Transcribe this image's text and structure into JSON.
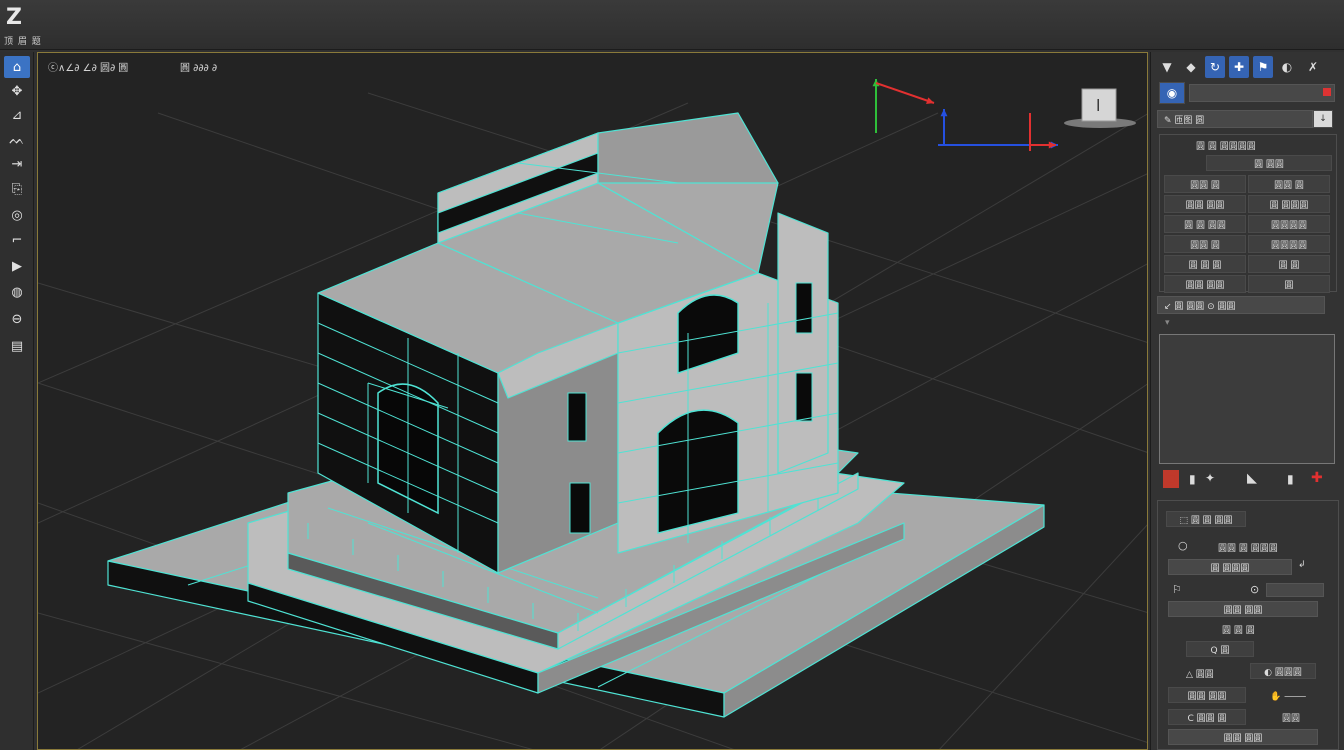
{
  "app": {
    "logo": "Z",
    "title": "顶 眉 题",
    "window_title": ""
  },
  "left_toolbar": {
    "items": [
      {
        "name": "home-tool",
        "glyph": "⌂",
        "active": true
      },
      {
        "name": "move-tool",
        "glyph": "✥"
      },
      {
        "name": "edge-tool",
        "glyph": "⊿"
      },
      {
        "name": "paint-tool",
        "glyph": "ᨓ"
      },
      {
        "name": "split-tool",
        "glyph": "⇥"
      },
      {
        "name": "render-tool",
        "glyph": "⎘"
      },
      {
        "name": "target-tool",
        "glyph": "◎"
      },
      {
        "name": "bevel-tool",
        "glyph": "⌐"
      },
      {
        "name": "camera-tool",
        "glyph": "▶"
      },
      {
        "name": "globe-tool",
        "glyph": "◍"
      },
      {
        "name": "layer-tool",
        "glyph": "⊖"
      },
      {
        "name": "stack-tool",
        "glyph": "▤"
      }
    ]
  },
  "viewport": {
    "label": "ⓒ∧∠∂ ∠∂ 圆∂ 圓",
    "label2": "圓 ∂∂∂ ∂",
    "view_cube_label": "l",
    "colors": {
      "wire": "#4fe3d4",
      "face_top": "#a9a9a9",
      "face_light": "#bdbdbd",
      "face_dark": "#101010",
      "face_mid": "#8c8c8c",
      "grid": "#3c3c3c",
      "axis_x": "#e23030",
      "axis_y": "#2fbf3a",
      "axis_z": "#2550e0"
    }
  },
  "right_panel": {
    "tabs": [
      "▼",
      "◆",
      "↻",
      "✚",
      "⚑",
      "◐",
      "✗"
    ],
    "search_value": "",
    "name_field": "✎ 匝图 圆",
    "name_field_right": "↓",
    "group1_title": "圓 圓 圓圓圓圓",
    "group1_subtitle": "圓 圓圓",
    "grid_buttons": [
      [
        "圓圓 圓",
        "圓圓 圓"
      ],
      [
        "圓圓 圓圓",
        "圓 圓圓圓"
      ],
      [
        "圓 圓 圓圓",
        "圓圓圓圓"
      ],
      [
        "圓圓 圓",
        "圓圓圓圓"
      ],
      [
        "圓 圓 圓",
        "圓 圓"
      ],
      [
        "圓圓 圓圓",
        "圓"
      ]
    ],
    "row_field": "↙ 圓 圓圓 ⊙ 圓圓",
    "swatch_tools": [
      "■",
      "▮",
      "✦",
      "◣",
      "▮",
      "✚"
    ],
    "section2_btn": "⬚ 圓 圓 圓圓",
    "radio_label": "圓圓 圓 圓圓圓",
    "field_a": "圓 圓圓圓",
    "field_a_icon": "↲",
    "field_b_icon": "⊙",
    "field_c": "圓圓 圓圓",
    "label_c": "圓 圓 圓",
    "q_btn": "Q 圓",
    "triangle_label": "△ 圓圓",
    "circle_btn": "◐ 圓圓圓",
    "row_d_left": "圓圓 圓圓",
    "row_d_right": "✋ ⸻",
    "row_e_left": "C 圓圓 圓",
    "row_e_right": "圓圓",
    "bottom_field": "圓圓 圓圓"
  }
}
